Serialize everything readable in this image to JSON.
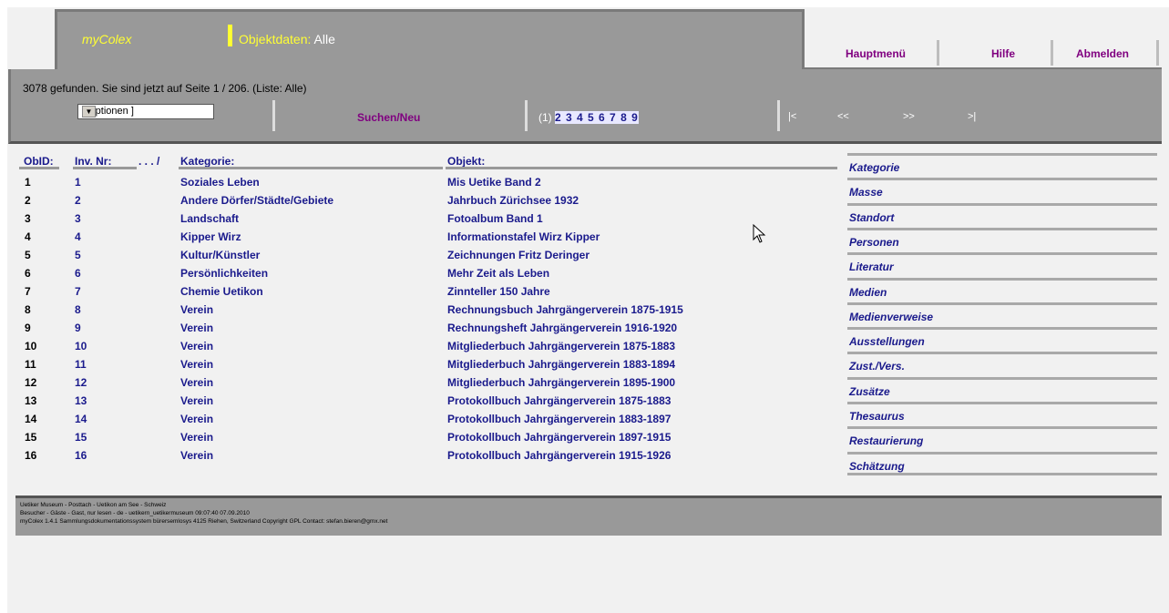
{
  "header": {
    "brand": "myColex",
    "crumb_label": "Objektdaten:",
    "crumb_value": "Alle",
    "nav": [
      "Hauptmenü",
      "Hilfe",
      "Abmelden"
    ]
  },
  "toolbar": {
    "found_text": "3078 gefunden. Sie sind jetzt auf Seite 1 / 206.  (Liste: Alle)",
    "options_select": "[ Optionen ]",
    "search_new": "Suchen/Neu",
    "current_page": "(1)",
    "page_numbers": "2 3 4 5 6 7 8 9",
    "nav_first": "|<",
    "nav_prev": "<<",
    "nav_next": ">>",
    "nav_last": ">|"
  },
  "table": {
    "headers": {
      "id": "ObID:",
      "inv": "Inv. Nr:",
      "dots": ". . . /",
      "kat": "Kategorie:",
      "obj": "Objekt:"
    },
    "rows": [
      {
        "id": "1",
        "inv": "1",
        "kat": "Soziales Leben",
        "obj": "Mis Uetike Band 2"
      },
      {
        "id": "2",
        "inv": "2",
        "kat": "Andere Dörfer/Städte/Gebiete",
        "obj": "Jahrbuch Zürichsee 1932"
      },
      {
        "id": "3",
        "inv": "3",
        "kat": "Landschaft",
        "obj": "Fotoalbum Band 1"
      },
      {
        "id": "4",
        "inv": "4",
        "kat": "Kipper Wirz",
        "obj": "Informationstafel Wirz Kipper"
      },
      {
        "id": "5",
        "inv": "5",
        "kat": "Kultur/Künstler",
        "obj": "Zeichnungen Fritz Deringer"
      },
      {
        "id": "6",
        "inv": "6",
        "kat": "Persönlichkeiten",
        "obj": "Mehr Zeit als Leben"
      },
      {
        "id": "7",
        "inv": "7",
        "kat": "Chemie Uetikon",
        "obj": "Zinnteller 150 Jahre"
      },
      {
        "id": "8",
        "inv": "8",
        "kat": "Verein",
        "obj": "Rechnungsbuch Jahrgängerverein 1875-1915"
      },
      {
        "id": "9",
        "inv": "9",
        "kat": "Verein",
        "obj": "Rechnungsheft Jahrgängerverein 1916-1920"
      },
      {
        "id": "10",
        "inv": "10",
        "kat": "Verein",
        "obj": "Mitgliederbuch Jahrgängerverein 1875-1883"
      },
      {
        "id": "11",
        "inv": "11",
        "kat": "Verein",
        "obj": "Mitgliederbuch Jahrgängerverein 1883-1894"
      },
      {
        "id": "12",
        "inv": "12",
        "kat": "Verein",
        "obj": "Mitgliederbuch Jahrgängerverein 1895-1900"
      },
      {
        "id": "13",
        "inv": "13",
        "kat": "Verein",
        "obj": "Protokollbuch Jahrgängerverein 1875-1883"
      },
      {
        "id": "14",
        "inv": "14",
        "kat": "Verein",
        "obj": "Protokollbuch Jahrgängerverein 1883-1897"
      },
      {
        "id": "15",
        "inv": "15",
        "kat": "Verein",
        "obj": "Protokollbuch Jahrgängerverein 1897-1915"
      },
      {
        "id": "16",
        "inv": "16",
        "kat": "Verein",
        "obj": "Protokollbuch Jahrgängerverein 1915-1926"
      }
    ]
  },
  "side_menu": [
    "Kategorie",
    "Masse",
    "Standort",
    "Personen",
    "Literatur",
    "Medien",
    "Medienverweise",
    "Ausstellungen",
    "Zust./Vers.",
    "Zusätze",
    "Thesaurus",
    "Restaurierung",
    "Schätzung"
  ],
  "footer": {
    "line1": "Uetiker Museum - Posttach - Uetikon am See - Schweiz",
    "line2": "Besucher - Gäste - Gast, nur lesen - de - uetikern_uetikermuseum 09:07:40 07.09.2010",
    "line3": "myColex 1.4.1 Sammlungsdokumentationssystem bürersemlosys 4125 Riehen, Switzerland Copyright GPL Contact: stefan.bieren@gmx.net"
  }
}
